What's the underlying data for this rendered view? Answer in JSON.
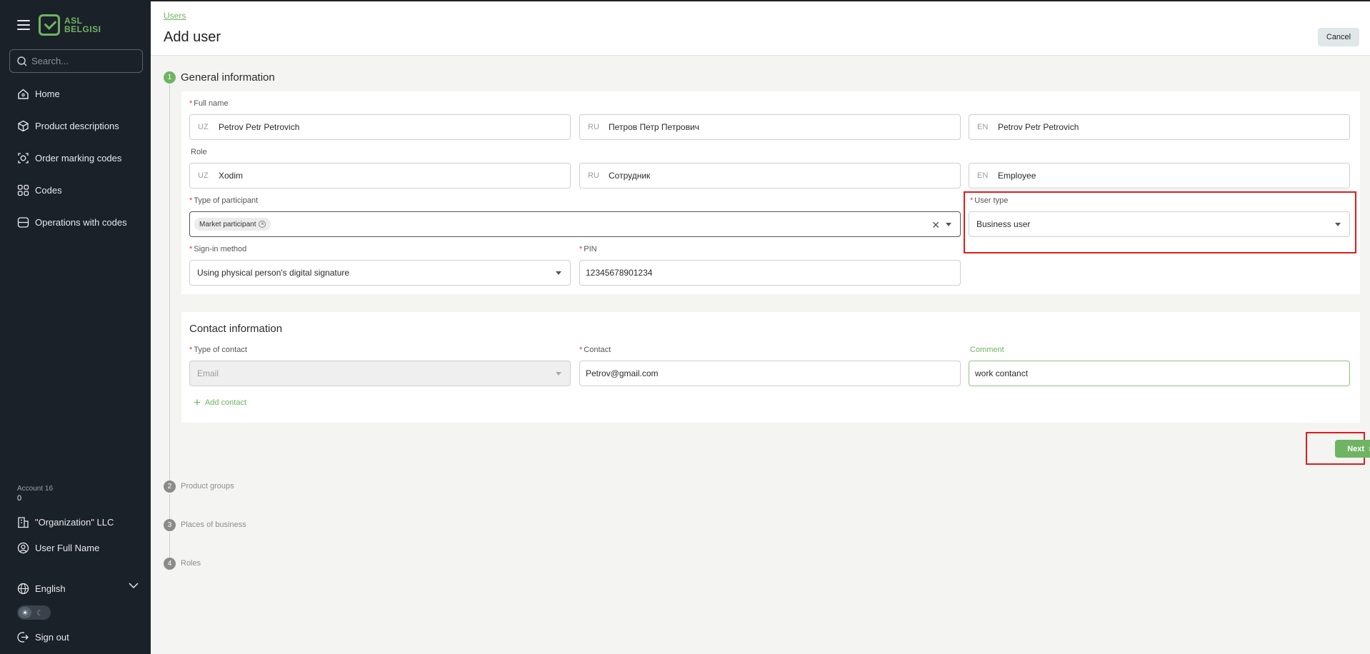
{
  "sidebar": {
    "logo_line1": "ASL",
    "logo_line2": "BELGISI",
    "search_placeholder": "Search...",
    "items": [
      {
        "label": "Home",
        "icon": "home-icon"
      },
      {
        "label": "Product descriptions",
        "icon": "cube-icon"
      },
      {
        "label": "Order marking codes",
        "icon": "order-codes-icon"
      },
      {
        "label": "Codes",
        "icon": "qr-codes-icon"
      },
      {
        "label": "Operations with codes",
        "icon": "operations-icon"
      }
    ],
    "account_label": "Account 16",
    "account_value": "0",
    "organization": "\"Organization\" LLC",
    "user_name": "User Full Name",
    "language": "English",
    "sign_out": "Sign out"
  },
  "header": {
    "breadcrumb": "Users",
    "title": "Add user",
    "cancel_label": "Cancel"
  },
  "steps": [
    {
      "number": "1",
      "label": "General information",
      "active": true
    },
    {
      "number": "2",
      "label": "Product groups",
      "active": false
    },
    {
      "number": "3",
      "label": "Places of business",
      "active": false
    },
    {
      "number": "4",
      "label": "Roles",
      "active": false
    }
  ],
  "general": {
    "full_name_label": "Full name",
    "full_name": [
      {
        "prefix": "UZ",
        "value": "Petrov Petr Petrovich"
      },
      {
        "prefix": "RU",
        "value": "Петров Петр Петрович"
      },
      {
        "prefix": "EN",
        "value": "Petrov Petr Petrovich"
      }
    ],
    "role_label": "Role",
    "role": [
      {
        "prefix": "UZ",
        "value": "Xodim"
      },
      {
        "prefix": "RU",
        "value": "Сотрудник"
      },
      {
        "prefix": "EN",
        "value": "Employee"
      }
    ],
    "participant_label": "Type of participant",
    "participant_chip": "Market participant",
    "user_type_label": "User type",
    "user_type": "Business user",
    "signin_label": "Sign-in method",
    "signin_value": "Using physical person's digital signature",
    "pin_label": "PIN",
    "pin_value": "12345678901234"
  },
  "contact": {
    "title": "Contact information",
    "type_label": "Type of contact",
    "type_value": "Email",
    "contact_label": "Contact",
    "contact_value": "Petrov@gmail.com",
    "comment_label": "Comment",
    "comment_value": "work contanct",
    "add_label": "Add contact"
  },
  "footer": {
    "next_label": "Next"
  },
  "colors": {
    "accent": "#6fb463",
    "sidebar_bg": "#1b2129",
    "highlight": "#e11b1b"
  }
}
